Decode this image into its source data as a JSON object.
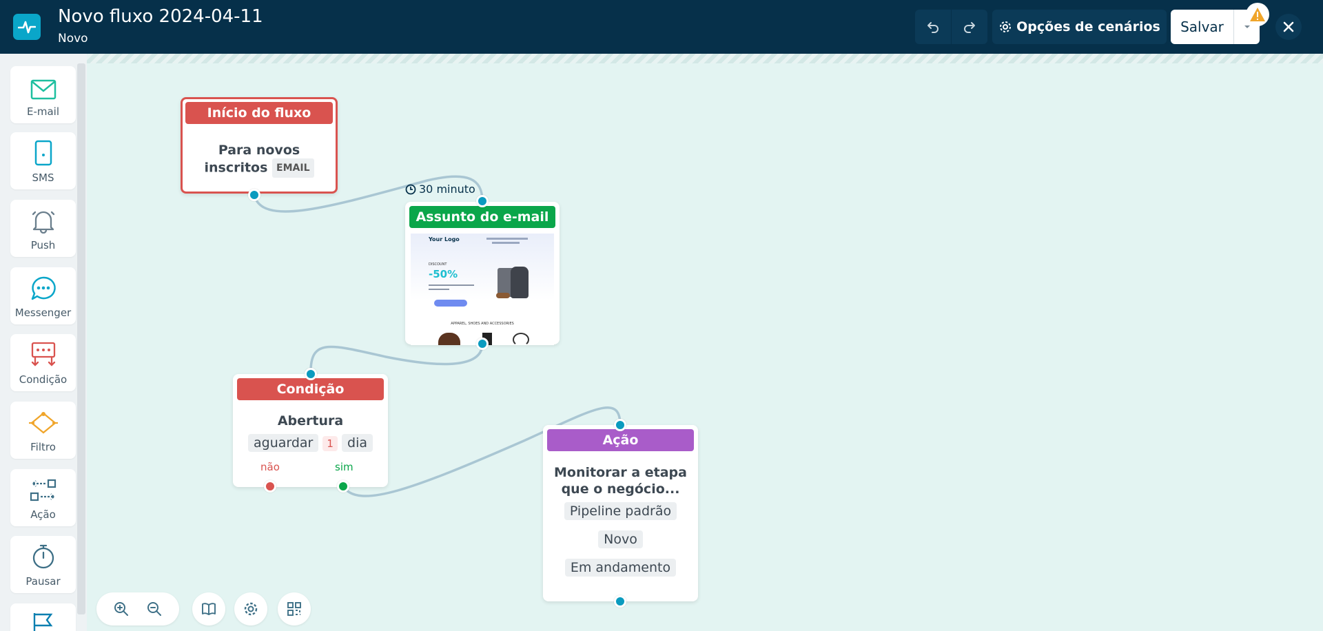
{
  "header": {
    "title": "Novo fluxo 2024-04-11",
    "subtitle": "Novo",
    "scenario_options_label": "Opções de cenários",
    "save_label": "Salvar"
  },
  "sidebar": {
    "items": [
      {
        "label": "E-mail",
        "icon": "envelope-icon"
      },
      {
        "label": "SMS",
        "icon": "phone-icon"
      },
      {
        "label": "Push",
        "icon": "bell-icon"
      },
      {
        "label": "Messenger",
        "icon": "chat-icon"
      },
      {
        "label": "Condição",
        "icon": "condition-icon"
      },
      {
        "label": "Filtro",
        "icon": "filter-icon"
      },
      {
        "label": "Ação",
        "icon": "action-icon"
      },
      {
        "label": "Pausar",
        "icon": "stopwatch-icon"
      }
    ]
  },
  "canvas": {
    "start_node": {
      "title": "Início do fluxo",
      "text": "Para novos inscritos",
      "tag": "EMAIL"
    },
    "email_node": {
      "delay": "30 minuto",
      "title": "Assunto do e-mail",
      "preview": {
        "logo": "Your Logo",
        "discount_label": "DISCOUNT",
        "discount": "-50%",
        "footer": "APPAREL, SHOES AND ACCESSORIES"
      }
    },
    "condition_node": {
      "title": "Condição",
      "text": "Abertura",
      "wait_label": "aguardar",
      "wait_value": "1",
      "wait_unit": "dia",
      "branch_no": "não",
      "branch_yes": "sim"
    },
    "action_node": {
      "title": "Ação",
      "text_line1": "Monitorar a etapa",
      "text_line2": "que o negócio...",
      "pipeline": "Pipeline padrão",
      "stage": "Novo",
      "status": "Em andamento"
    }
  },
  "colors": {
    "header_bg": "#06304a",
    "canvas_bg": "#e3f4f2",
    "start_red": "#d9534f",
    "email_green": "#0aa64a",
    "condition_red": "#d9534f",
    "action_purple": "#a95cc9",
    "port_blue": "#0a9bbf"
  }
}
